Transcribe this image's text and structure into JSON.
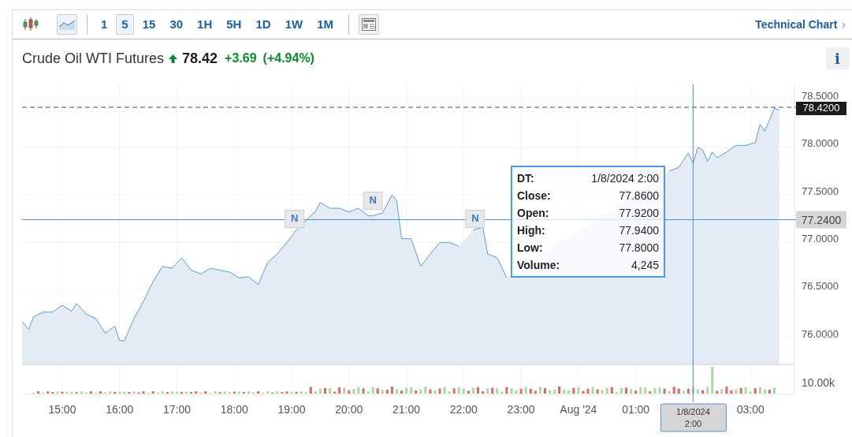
{
  "toolbar": {
    "chart_types": [
      {
        "kind": "candlestick",
        "selected": false
      },
      {
        "kind": "area",
        "selected": true
      }
    ],
    "intervals": [
      {
        "label": "1",
        "selected": false
      },
      {
        "label": "5",
        "selected": true
      },
      {
        "label": "15",
        "selected": false
      },
      {
        "label": "30",
        "selected": false
      },
      {
        "label": "1H",
        "selected": false
      },
      {
        "label": "5H",
        "selected": false
      },
      {
        "label": "1D",
        "selected": false
      },
      {
        "label": "1W",
        "selected": false
      },
      {
        "label": "1M",
        "selected": false
      }
    ],
    "link": {
      "label": "Technical Chart",
      "arrow": "›"
    }
  },
  "quote": {
    "name": "Crude Oil WTI Futures",
    "trend_up": true,
    "price": "78.42",
    "change": "+3.69",
    "change_percent": "(+4.94%)",
    "info_button": "i"
  },
  "chart": {
    "chart_data": {
      "type": "area",
      "grid": true,
      "xlim": [
        "2024-07-31T14:18",
        "2024-08-01T03:46"
      ],
      "ylim": [
        75.72,
        78.66
      ],
      "xticks": [
        {
          "value": "2024-07-31T15:00",
          "label": "15:00"
        },
        {
          "value": "2024-07-31T16:00",
          "label": "16:00"
        },
        {
          "value": "2024-07-31T17:00",
          "label": "17:00"
        },
        {
          "value": "2024-07-31T18:00",
          "label": "18:00"
        },
        {
          "value": "2024-07-31T19:00",
          "label": "19:00"
        },
        {
          "value": "2024-07-31T20:00",
          "label": "20:00"
        },
        {
          "value": "2024-07-31T21:00",
          "label": "21:00"
        },
        {
          "value": "2024-07-31T22:00",
          "label": "22:00"
        },
        {
          "value": "2024-07-31T23:00",
          "label": "23:00"
        },
        {
          "value": "2024-08-01T00:00",
          "label": "Aug '24"
        },
        {
          "value": "2024-08-01T01:00",
          "label": "01:00"
        },
        {
          "value": "2024-08-01T03:00",
          "label": "03:00"
        }
      ],
      "yticks": [
        {
          "value": 76,
          "label": "76.0000"
        },
        {
          "value": 76.5,
          "label": "76.5000"
        },
        {
          "value": 77,
          "label": "77.0000"
        },
        {
          "value": 77.5,
          "label": "77.5000"
        },
        {
          "value": 78,
          "label": "78.0000"
        },
        {
          "value": 78.5,
          "label": "78.5000"
        }
      ],
      "x": [
        "2024-07-31T14:18",
        "2024-07-31T14:25",
        "2024-07-31T14:30",
        "2024-07-31T14:40",
        "2024-07-31T14:50",
        "2024-07-31T15:00",
        "2024-07-31T15:10",
        "2024-07-31T15:15",
        "2024-07-31T15:25",
        "2024-07-31T15:35",
        "2024-07-31T15:45",
        "2024-07-31T15:55",
        "2024-07-31T16:00",
        "2024-07-31T16:05",
        "2024-07-31T16:15",
        "2024-07-31T16:25",
        "2024-07-31T16:35",
        "2024-07-31T16:45",
        "2024-07-31T16:55",
        "2024-07-31T17:05",
        "2024-07-31T17:15",
        "2024-07-31T17:25",
        "2024-07-31T17:35",
        "2024-07-31T17:45",
        "2024-07-31T17:55",
        "2024-07-31T18:05",
        "2024-07-31T18:15",
        "2024-07-31T18:25",
        "2024-07-31T18:35",
        "2024-07-31T18:45",
        "2024-07-31T18:55",
        "2024-07-31T19:05",
        "2024-07-31T19:15",
        "2024-07-31T19:25",
        "2024-07-31T19:30",
        "2024-07-31T19:40",
        "2024-07-31T19:50",
        "2024-07-31T20:00",
        "2024-07-31T20:10",
        "2024-07-31T20:20",
        "2024-07-31T20:25",
        "2024-07-31T20:35",
        "2024-07-31T20:45",
        "2024-07-31T20:50",
        "2024-07-31T20:55",
        "2024-07-31T21:05",
        "2024-07-31T21:15",
        "2024-07-31T21:25",
        "2024-07-31T21:35",
        "2024-07-31T21:45",
        "2024-07-31T21:55",
        "2024-07-31T22:05",
        "2024-07-31T22:10",
        "2024-07-31T22:20",
        "2024-07-31T22:25",
        "2024-07-31T22:35",
        "2024-07-31T22:45",
        "2024-07-31T22:55",
        "2024-07-31T23:05",
        "2024-07-31T23:15",
        "2024-07-31T23:25",
        "2024-07-31T23:35",
        "2024-07-31T23:45",
        "2024-07-31T23:55",
        "2024-08-01T00:05",
        "2024-08-01T00:15",
        "2024-08-01T00:25",
        "2024-08-01T00:35",
        "2024-08-01T00:45",
        "2024-08-01T00:55",
        "2024-08-01T01:05",
        "2024-08-01T01:15",
        "2024-08-01T01:25",
        "2024-08-01T01:35",
        "2024-08-01T01:45",
        "2024-08-01T01:55",
        "2024-08-01T02:00",
        "2024-08-01T02:05",
        "2024-08-01T02:10",
        "2024-08-01T02:15",
        "2024-08-01T02:20",
        "2024-08-01T02:25",
        "2024-08-01T02:35",
        "2024-08-01T02:45",
        "2024-08-01T02:55",
        "2024-08-01T03:05",
        "2024-08-01T03:10",
        "2024-08-01T03:15",
        "2024-08-01T03:25",
        "2024-08-01T03:30"
      ],
      "series": [
        {
          "color": "#5b9bd5",
          "values": [
            76.17,
            76.09,
            76.22,
            76.27,
            76.27,
            76.34,
            76.28,
            76.36,
            76.25,
            76.2,
            76.05,
            76.12,
            75.97,
            75.97,
            76.2,
            76.38,
            76.59,
            76.75,
            76.73,
            76.84,
            76.71,
            76.67,
            76.73,
            76.71,
            76.69,
            76.63,
            76.64,
            76.56,
            76.79,
            76.88,
            77,
            77.13,
            77.23,
            77.33,
            77.42,
            77.36,
            77.36,
            77.32,
            77.36,
            77.28,
            77.28,
            77.31,
            77.5,
            77.44,
            77.04,
            77.04,
            76.75,
            76.88,
            77,
            77,
            76.96,
            null,
            77.13,
            77.16,
            76.88,
            76.84,
            76.63,
            null,
            null,
            null,
            null,
            null,
            null,
            null,
            null,
            null,
            null,
            null,
            null,
            null,
            null,
            null,
            null,
            77.75,
            77.79,
            77.94,
            77.83,
            78,
            77.97,
            77.85,
            77.95,
            77.89,
            77.95,
            78.02,
            78.02,
            78.05,
            78.24,
            78.17,
            78.41,
            78.39
          ]
        }
      ],
      "ref_lines": [
        {
          "axis": "y",
          "value": 78.42,
          "color": "#888888",
          "label": "78.4200"
        },
        {
          "axis": "y",
          "value": 77.24,
          "color": "#4a90d9",
          "label": "77.2400"
        },
        {
          "axis": "x",
          "value": "2024-08-01T02:00",
          "color": "#4a90d9",
          "label": [
            "1/8/2024",
            "2:00"
          ]
        }
      ],
      "annotations": [
        {
          "x": "2024-07-31T19:03",
          "y": 77.24,
          "text": "N"
        },
        {
          "x": "2024-07-31T20:25",
          "y": 77.43,
          "text": "N"
        },
        {
          "x": "2024-07-31T22:12",
          "y": 77.24,
          "text": "N"
        }
      ]
    },
    "volume_axis_label": "10.00k",
    "tooltip": [
      {
        "label": "DT:",
        "value": "1/8/2024 2:00"
      },
      {
        "label": "Close:",
        "value": "77.8600"
      },
      {
        "label": "Open:",
        "value": "77.9200"
      },
      {
        "label": "High:",
        "value": "77.9400"
      },
      {
        "label": "Low:",
        "value": "77.8000"
      },
      {
        "label": "Volume:",
        "value": "4,245"
      }
    ]
  }
}
